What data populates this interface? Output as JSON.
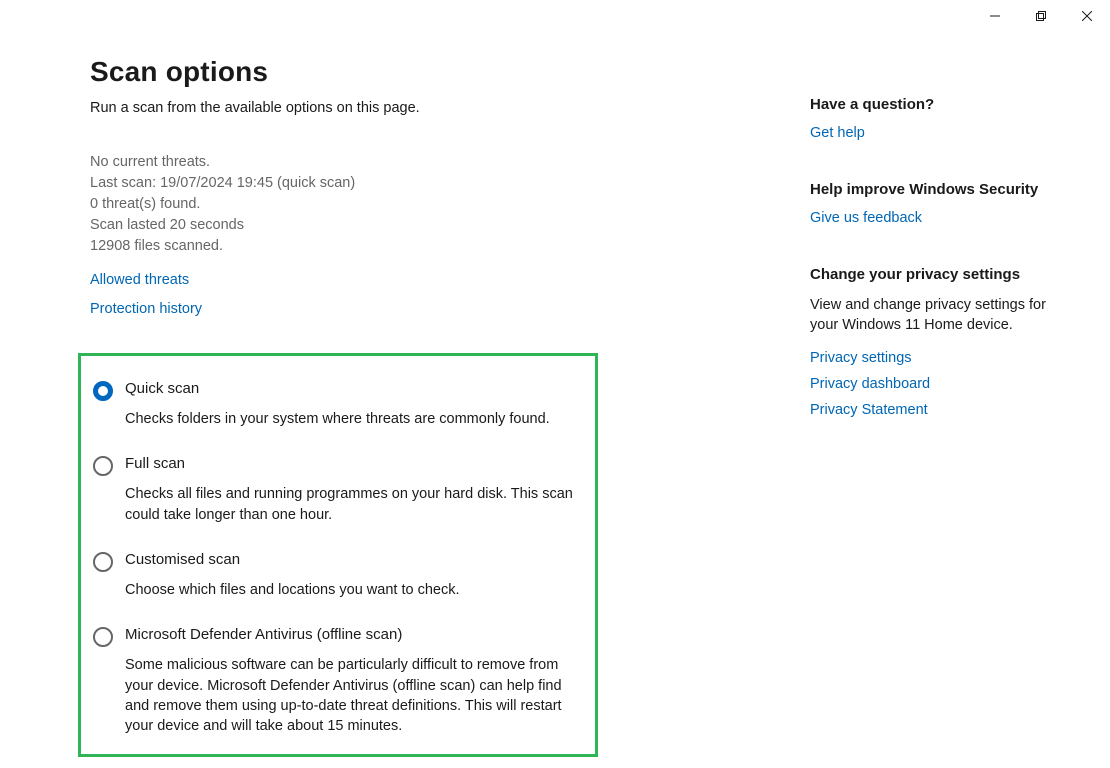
{
  "header": {
    "title": "Scan options",
    "subtitle": "Run a scan from the available options on this page."
  },
  "status": {
    "no_threats": "No current threats.",
    "last_scan": "Last scan: 19/07/2024 19:45 (quick scan)",
    "threats_found": "0 threat(s) found.",
    "duration": "Scan lasted 20 seconds",
    "files_scanned": "12908 files scanned."
  },
  "links": {
    "allowed_threats": "Allowed threats",
    "protection_history": "Protection history"
  },
  "options": [
    {
      "title": "Quick scan",
      "desc": "Checks folders in your system where threats are commonly found.",
      "checked": true
    },
    {
      "title": "Full scan",
      "desc": "Checks all files and running programmes on your hard disk. This scan could take longer than one hour.",
      "checked": false
    },
    {
      "title": "Customised scan",
      "desc": "Choose which files and locations you want to check.",
      "checked": false
    },
    {
      "title": "Microsoft Defender Antivirus (offline scan)",
      "desc": "Some malicious software can be particularly difficult to remove from your device. Microsoft Defender Antivirus (offline scan) can help find and remove them using up-to-date threat definitions. This will restart your device and will take about 15 minutes.",
      "checked": false
    }
  ],
  "right": {
    "question": {
      "heading": "Have a question?",
      "link": "Get help"
    },
    "improve": {
      "heading": "Help improve Windows Security",
      "link": "Give us feedback"
    },
    "privacy": {
      "heading": "Change your privacy settings",
      "text": "View and change privacy settings for your Windows 11 Home device.",
      "links": [
        "Privacy settings",
        "Privacy dashboard",
        "Privacy Statement"
      ]
    }
  }
}
